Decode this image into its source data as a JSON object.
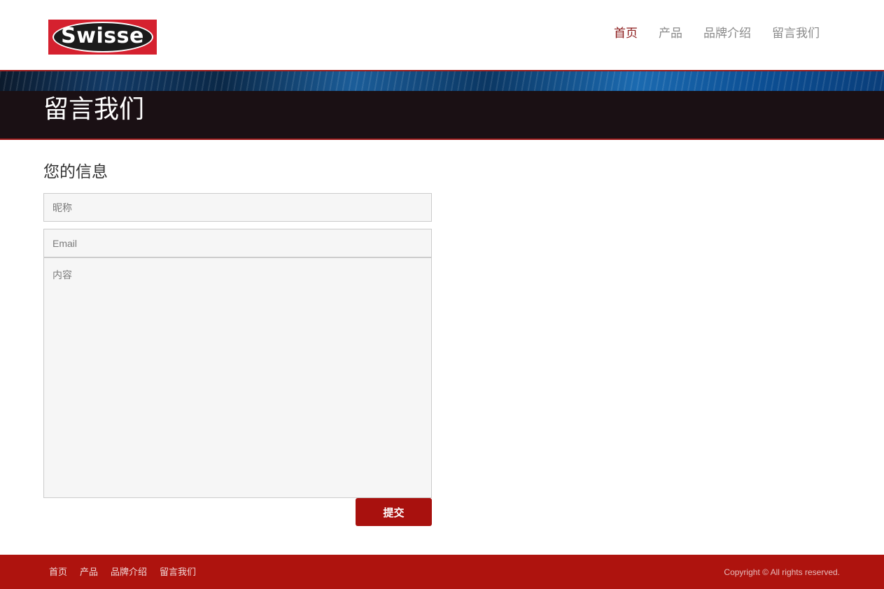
{
  "header": {
    "logo_text": "Swisse",
    "nav": [
      {
        "label": "首页",
        "active": true
      },
      {
        "label": "产品",
        "active": false
      },
      {
        "label": "品牌介绍",
        "active": false
      },
      {
        "label": "留言我们",
        "active": false
      }
    ]
  },
  "banner": {
    "title": "留言我们"
  },
  "form": {
    "heading": "您的信息",
    "nickname_placeholder": "昵称",
    "email_placeholder": "Email",
    "content_placeholder": "内容",
    "submit_label": "提交"
  },
  "footer": {
    "links": [
      "首页",
      "产品",
      "品牌介绍",
      "留言我们"
    ],
    "copyright": "Copyright © All rights reserved."
  },
  "colors": {
    "brand_red": "#ae130e",
    "nav_active": "#8b1a1a",
    "banner_dark": "#1a1014"
  }
}
